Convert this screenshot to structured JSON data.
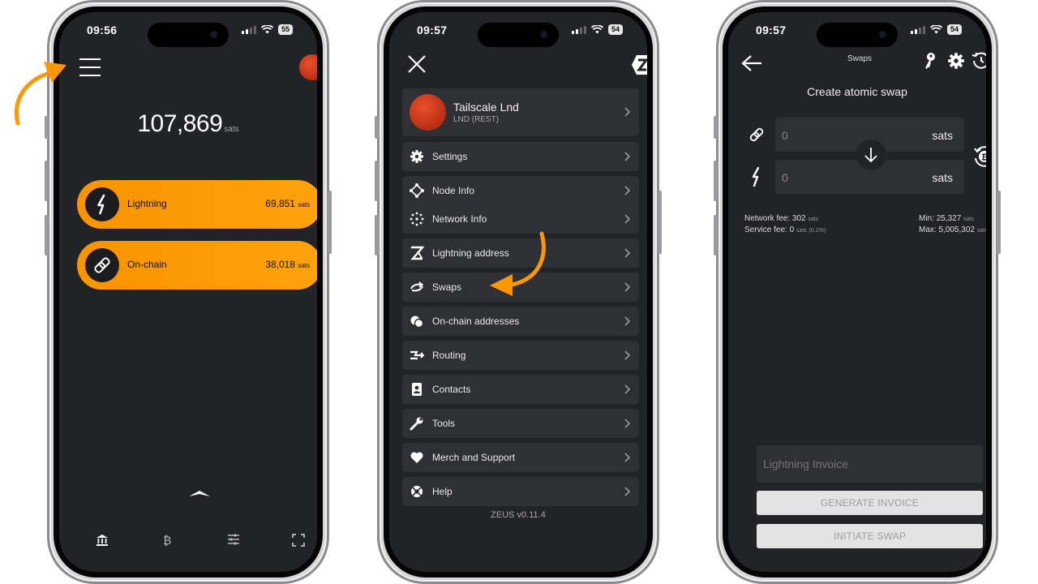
{
  "colors": {
    "accent": "#FF9800",
    "screen_bg": "#222327",
    "card_bg": "#2F3036"
  },
  "phone1": {
    "status": {
      "time": "09:56",
      "battery": "55"
    },
    "balance": {
      "amount": "107,869",
      "unit": "sats"
    },
    "accounts": [
      {
        "label": "Lightning",
        "amount": "69,851",
        "unit": "sats",
        "icon": "lightning-icon"
      },
      {
        "label": "On-chain",
        "amount": "38,018",
        "unit": "sats",
        "icon": "chain-link-icon"
      }
    ],
    "nav_icons": [
      "bank-icon",
      "bitcoin-icon",
      "list-icon",
      "scan-icon"
    ]
  },
  "phone2": {
    "status": {
      "time": "09:57",
      "battery": "54"
    },
    "node": {
      "name": "Tailscale Lnd",
      "type": "LND (REST)"
    },
    "menu": [
      {
        "label": "Settings",
        "icon": "gear-icon"
      },
      {
        "label": "Node Info",
        "icon": "node-icon"
      },
      {
        "label": "Network Info",
        "icon": "network-icon"
      },
      {
        "label": "Lightning address",
        "icon": "zeus-z-icon"
      },
      {
        "label": "Swaps",
        "icon": "swap-icon"
      },
      {
        "label": "On-chain addresses",
        "icon": "coins-icon"
      },
      {
        "label": "Routing",
        "icon": "routing-icon"
      },
      {
        "label": "Contacts",
        "icon": "contacts-icon"
      },
      {
        "label": "Tools",
        "icon": "wrench-icon"
      },
      {
        "label": "Merch and Support",
        "icon": "heart-icon"
      },
      {
        "label": "Help",
        "icon": "lifebuoy-icon"
      }
    ],
    "version": "ZEUS v0.11.4"
  },
  "phone3": {
    "status": {
      "time": "09:57",
      "battery": "54"
    },
    "header_title": "Swaps",
    "subtitle": "Create atomic swap",
    "from": {
      "value": "0",
      "unit": "sats"
    },
    "to": {
      "value": "0",
      "unit": "sats"
    },
    "fees": {
      "network_label": "Network fee:",
      "network_value": "302",
      "network_unit": "sats",
      "service_label": "Service fee:",
      "service_value": "0",
      "service_unit": "sats",
      "service_pct": "(0.1%)",
      "min_label": "Min:",
      "min_value": "25,327",
      "min_unit": "sats",
      "max_label": "Max:",
      "max_value": "5,005,302",
      "max_unit": "sats"
    },
    "invoice_placeholder": "Lightning Invoice",
    "generate_label": "GENERATE INVOICE",
    "initiate_label": "INITIATE SWAP"
  }
}
